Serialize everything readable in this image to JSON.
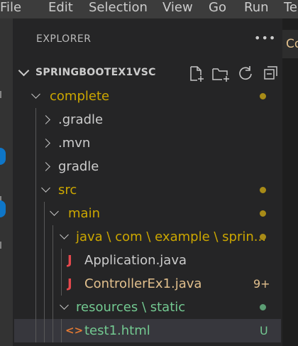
{
  "menubar": {
    "items": [
      "File",
      "Edit",
      "Selection",
      "View",
      "Go",
      "Run",
      "Te"
    ]
  },
  "explorer": {
    "title": "EXPLORER",
    "more_icon": "more-actions-icon",
    "section_title": "SPRINGBOOTEX1VSC",
    "header_icons": [
      "new-file-icon",
      "new-folder-icon",
      "refresh-icon",
      "collapse-all-icon"
    ]
  },
  "editor_tab": {
    "label": "Co"
  },
  "tree": [
    {
      "label": "complete",
      "kind": "folder",
      "expanded": true,
      "status": "modified"
    },
    {
      "label": ".gradle",
      "kind": "folder",
      "expanded": false
    },
    {
      "label": ".mvn",
      "kind": "folder",
      "expanded": false
    },
    {
      "label": "gradle",
      "kind": "folder",
      "expanded": false
    },
    {
      "label": "src",
      "kind": "folder",
      "expanded": true,
      "status": "modified"
    },
    {
      "label": "main",
      "kind": "folder",
      "expanded": true,
      "status": "modified"
    },
    {
      "label": "java \\ com \\ example \\ sprin...",
      "kind": "folder",
      "expanded": true,
      "status": "modified"
    },
    {
      "label": "Application.java",
      "kind": "java-file",
      "icon": "J"
    },
    {
      "label": "ControllerEx1.java",
      "kind": "java-file",
      "icon": "J",
      "badge": "9+"
    },
    {
      "label": "resources \\ static",
      "kind": "folder",
      "expanded": true,
      "status": "untracked"
    },
    {
      "label": "test1.html",
      "kind": "html-file",
      "icon": "<>",
      "badge": "U",
      "selected": true
    }
  ],
  "colors": {
    "modified": "#cca700",
    "untracked": "#73c991",
    "error": "#f48771",
    "java_icon": "#e5484d",
    "html_icon": "#e37933",
    "accent_badge": "#0e76c8"
  }
}
